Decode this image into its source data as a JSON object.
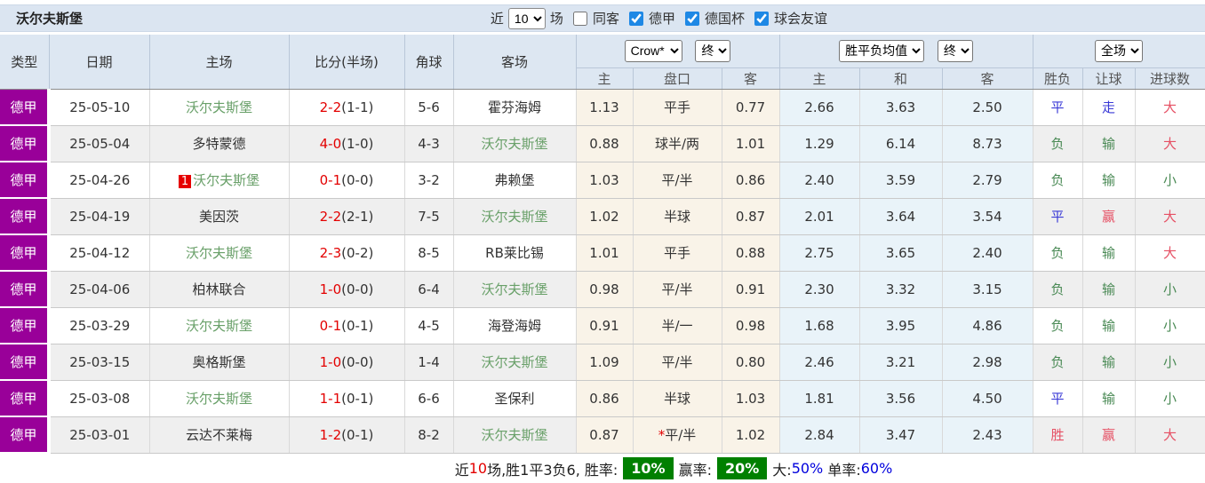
{
  "topbar": {
    "title": "沃尔夫斯堡",
    "recent_label": "近",
    "recent_select": "10",
    "matches_label": "场",
    "filters": [
      {
        "label": "同客",
        "checked": false
      },
      {
        "label": "德甲",
        "checked": true
      },
      {
        "label": "德国杯",
        "checked": true
      },
      {
        "label": "球会友谊",
        "checked": true
      }
    ]
  },
  "header": {
    "static_cols": [
      "类型",
      "日期",
      "主场",
      "比分(半场)",
      "角球",
      "客场"
    ],
    "groups": [
      {
        "selects": [
          "Crow*",
          "终"
        ],
        "cols": [
          "主",
          "盘口",
          "客"
        ]
      },
      {
        "selects": [
          "胜平负均值",
          "终"
        ],
        "cols": [
          "主",
          "和",
          "客"
        ]
      },
      {
        "selects": [
          "全场"
        ],
        "cols": [
          "胜负",
          "让球",
          "进球数"
        ]
      }
    ]
  },
  "rows": [
    {
      "type": "德甲",
      "date": "25-05-10",
      "home": "沃尔夫斯堡",
      "home_badge": "",
      "score": "2-2",
      "half": "(1-1)",
      "corners": "5-6",
      "away": "霍芬海姆",
      "ah_home": "1.13",
      "ah_line": "平手",
      "ah_away": "0.77",
      "odds_home": "2.66",
      "odds_draw": "3.63",
      "odds_away": "2.50",
      "result": "平",
      "handicap_result": "走",
      "goals": "大"
    },
    {
      "type": "德甲",
      "date": "25-05-04",
      "home": "多特蒙德",
      "home_badge": "",
      "score": "4-0",
      "half": "(1-0)",
      "corners": "4-3",
      "away": "沃尔夫斯堡",
      "ah_home": "0.88",
      "ah_line": "球半/两",
      "ah_away": "1.01",
      "odds_home": "1.29",
      "odds_draw": "6.14",
      "odds_away": "8.73",
      "result": "负",
      "handicap_result": "输",
      "goals": "大"
    },
    {
      "type": "德甲",
      "date": "25-04-26",
      "home": "沃尔夫斯堡",
      "home_badge": "1",
      "score": "0-1",
      "half": "(0-0)",
      "corners": "3-2",
      "away": "弗赖堡",
      "ah_home": "1.03",
      "ah_line": "平/半",
      "ah_away": "0.86",
      "odds_home": "2.40",
      "odds_draw": "3.59",
      "odds_away": "2.79",
      "result": "负",
      "handicap_result": "输",
      "goals": "小"
    },
    {
      "type": "德甲",
      "date": "25-04-19",
      "home": "美因茨",
      "home_badge": "",
      "score": "2-2",
      "half": "(2-1)",
      "corners": "7-5",
      "away": "沃尔夫斯堡",
      "ah_home": "1.02",
      "ah_line": "半球",
      "ah_away": "0.87",
      "odds_home": "2.01",
      "odds_draw": "3.64",
      "odds_away": "3.54",
      "result": "平",
      "handicap_result": "赢",
      "goals": "大"
    },
    {
      "type": "德甲",
      "date": "25-04-12",
      "home": "沃尔夫斯堡",
      "home_badge": "",
      "score": "2-3",
      "half": "(0-2)",
      "corners": "8-5",
      "away": "RB莱比锡",
      "ah_home": "1.01",
      "ah_line": "平手",
      "ah_away": "0.88",
      "odds_home": "2.75",
      "odds_draw": "3.65",
      "odds_away": "2.40",
      "result": "负",
      "handicap_result": "输",
      "goals": "大"
    },
    {
      "type": "德甲",
      "date": "25-04-06",
      "home": "柏林联合",
      "home_badge": "",
      "score": "1-0",
      "half": "(0-0)",
      "corners": "6-4",
      "away": "沃尔夫斯堡",
      "ah_home": "0.98",
      "ah_line": "平/半",
      "ah_away": "0.91",
      "odds_home": "2.30",
      "odds_draw": "3.32",
      "odds_away": "3.15",
      "result": "负",
      "handicap_result": "输",
      "goals": "小"
    },
    {
      "type": "德甲",
      "date": "25-03-29",
      "home": "沃尔夫斯堡",
      "home_badge": "",
      "score": "0-1",
      "half": "(0-1)",
      "corners": "4-5",
      "away": "海登海姆",
      "ah_home": "0.91",
      "ah_line": "半/一",
      "ah_away": "0.98",
      "odds_home": "1.68",
      "odds_draw": "3.95",
      "odds_away": "4.86",
      "result": "负",
      "handicap_result": "输",
      "goals": "小"
    },
    {
      "type": "德甲",
      "date": "25-03-15",
      "home": "奥格斯堡",
      "home_badge": "",
      "score": "1-0",
      "half": "(0-0)",
      "corners": "1-4",
      "away": "沃尔夫斯堡",
      "ah_home": "1.09",
      "ah_line": "平/半",
      "ah_away": "0.80",
      "odds_home": "2.46",
      "odds_draw": "3.21",
      "odds_away": "2.98",
      "result": "负",
      "handicap_result": "输",
      "goals": "小"
    },
    {
      "type": "德甲",
      "date": "25-03-08",
      "home": "沃尔夫斯堡",
      "home_badge": "",
      "score": "1-1",
      "half": "(0-1)",
      "corners": "6-6",
      "away": "圣保利",
      "ah_home": "0.86",
      "ah_line": "半球",
      "ah_away": "1.03",
      "odds_home": "1.81",
      "odds_draw": "3.56",
      "odds_away": "4.50",
      "result": "平",
      "handicap_result": "输",
      "goals": "小"
    },
    {
      "type": "德甲",
      "date": "25-03-01",
      "home": "云达不莱梅",
      "home_badge": "",
      "score": "1-2",
      "half": "(0-1)",
      "corners": "8-2",
      "away": "沃尔夫斯堡",
      "ah_home": "0.87",
      "ah_line": "*平/半",
      "ah_away": "1.02",
      "odds_home": "2.84",
      "odds_draw": "3.47",
      "odds_away": "2.43",
      "result": "胜",
      "handicap_result": "赢",
      "goals": "大"
    }
  ],
  "footer": {
    "segments": [
      {
        "text": "近",
        "c": "d"
      },
      {
        "text": "10",
        "c": "r"
      },
      {
        "text": "场,胜1平3负6, 胜率:",
        "c": "d"
      },
      {
        "text": "10%",
        "c": "badge"
      },
      {
        "text": "赢率:",
        "c": "d"
      },
      {
        "text": "20%",
        "c": "badge"
      },
      {
        "text": "大:",
        "c": "d"
      },
      {
        "text": "50%",
        "c": "b"
      },
      {
        "text": " 单率:",
        "c": "d"
      },
      {
        "text": "60%",
        "c": "b"
      }
    ]
  },
  "colors": {
    "type_badge": "#990099",
    "focus_team": "#69a069",
    "score_red": "#e30000",
    "result_win_red": "#e65064",
    "result_draw_blue": "#3a3ad6",
    "result_loss_green": "#4a8a55",
    "footer_badge_green": "#008000",
    "footer_blue": "#0000dd",
    "header_bg": "#dde7f2",
    "handicap_col_bg": "#f9f3e8",
    "odds_col_bg": "#e9f3f9"
  }
}
